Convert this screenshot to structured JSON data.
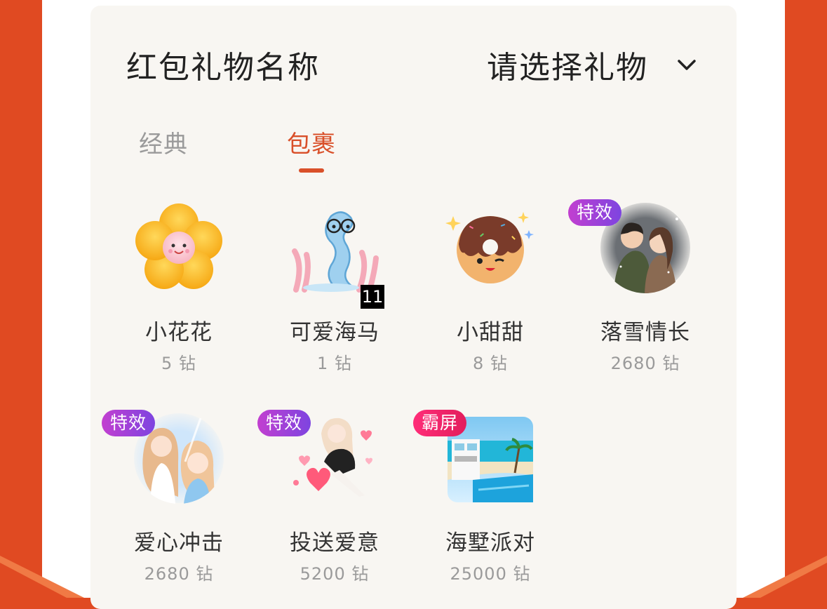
{
  "header": {
    "title": "红包礼物名称",
    "select_label": "请选择礼物"
  },
  "tabs": [
    {
      "label": "经典",
      "active": false
    },
    {
      "label": "包裹",
      "active": true
    }
  ],
  "gifts": [
    {
      "name": "小花花",
      "price": "5 钻",
      "icon": "flower-icon"
    },
    {
      "name": "可爱海马",
      "price": "1 钻",
      "icon": "seahorse-icon",
      "count": "11"
    },
    {
      "name": "小甜甜",
      "price": "8 钻",
      "icon": "donut-icon"
    },
    {
      "name": "落雪情长",
      "price": "2680 钻",
      "icon": "couple-snow-image",
      "badge": "特效"
    },
    {
      "name": "爱心冲击",
      "price": "2680 钻",
      "icon": "twin-girls-image",
      "badge": "特效"
    },
    {
      "name": "投送爱意",
      "price": "5200 钻",
      "icon": "girl-hearts-image",
      "badge": "特效"
    },
    {
      "name": "海墅派对",
      "price": "25000 钻",
      "icon": "beach-villa-image",
      "badge": "霸屏"
    }
  ],
  "colors": {
    "accent": "#d9502a",
    "background": "#e04a22",
    "panel": "#f8f6f2",
    "badge_effect": "#9a42d8",
    "badge_screen": "#f0246a"
  }
}
